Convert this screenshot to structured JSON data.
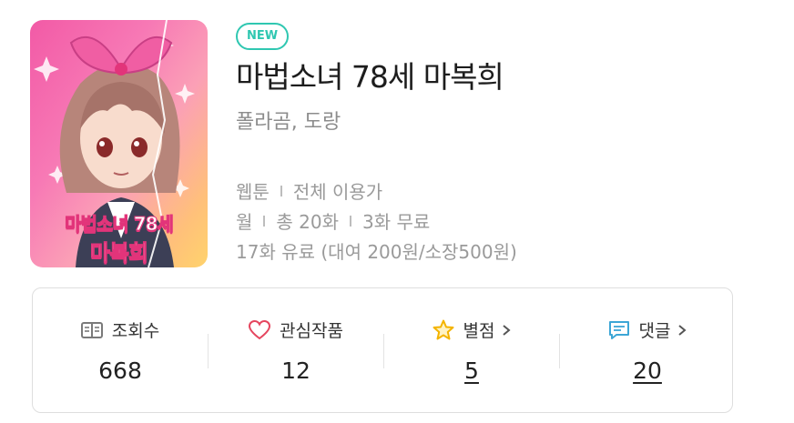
{
  "cover": {
    "title_line1": "마법소녀 78세",
    "title_line2": "마복희"
  },
  "badge": "NEW",
  "title": "마법소녀 78세 마복희",
  "authors": "폴라곰, 도랑",
  "meta": {
    "format": "웹툰",
    "rating": "전체 이용가",
    "schedule": "월",
    "total": "총 20화",
    "free": "3화 무료",
    "paid": "17화 유료 (대여 200원/소장500원)"
  },
  "stats": {
    "views": {
      "label": "조회수",
      "value": "668",
      "icon": "book-icon"
    },
    "favorites": {
      "label": "관심작품",
      "value": "12",
      "icon": "heart-icon"
    },
    "rating": {
      "label": "별점",
      "value": "5",
      "icon": "star-icon"
    },
    "comments": {
      "label": "댓글",
      "value": "20",
      "icon": "comment-icon"
    }
  },
  "colors": {
    "accent": "#2fc7b1",
    "heart": "#e5455e",
    "star": "#f4b400",
    "comment": "#3ca6d6"
  }
}
